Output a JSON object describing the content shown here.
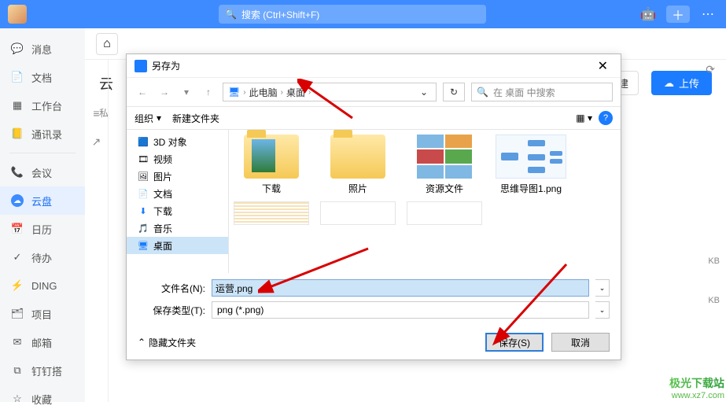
{
  "topbar": {
    "search_placeholder": "搜索 (Ctrl+Shift+F)"
  },
  "sidebar": {
    "items": [
      {
        "icon": "💬",
        "label": "消息"
      },
      {
        "icon": "📄",
        "label": "文档"
      },
      {
        "icon": "▦",
        "label": "工作台"
      },
      {
        "icon": "📒",
        "label": "通讯录"
      }
    ],
    "items2": [
      {
        "icon": "📞",
        "label": "会议"
      },
      {
        "icon": "☁",
        "label": "云盘",
        "active": true
      },
      {
        "icon": "📅",
        "label": "日历"
      },
      {
        "icon": "✓",
        "label": "待办"
      },
      {
        "icon": "⚡",
        "label": "DING"
      },
      {
        "icon": "🗂",
        "label": "项目"
      },
      {
        "icon": "✉",
        "label": "邮箱"
      },
      {
        "icon": "⧉",
        "label": "钉钉搭"
      },
      {
        "icon": "☆",
        "label": "收藏"
      }
    ]
  },
  "main": {
    "yun_title": "云",
    "private_label": "私",
    "new_btn": "建",
    "upload_btn": "上传",
    "kb_col": "KB"
  },
  "dialog": {
    "title": "另存为",
    "path": {
      "root": "此电脑",
      "leaf": "桌面"
    },
    "search_placeholder": "在 桌面 中搜索",
    "toolbar": {
      "organize": "组织",
      "newfolder": "新建文件夹"
    },
    "tree": [
      {
        "icon": "🟦",
        "label": "3D 对象"
      },
      {
        "icon": "🎞",
        "label": "视频"
      },
      {
        "icon": "🖼",
        "label": "图片"
      },
      {
        "icon": "📄",
        "label": "文档"
      },
      {
        "icon": "⬇",
        "label": "下载"
      },
      {
        "icon": "🎵",
        "label": "音乐"
      },
      {
        "icon": "🖥",
        "label": "桌面",
        "sel": true
      }
    ],
    "files": [
      {
        "label": "下载",
        "type": "folder-preview"
      },
      {
        "label": "照片",
        "type": "folder"
      },
      {
        "label": "资源文件",
        "type": "thumbs"
      },
      {
        "label": "思维导图1.png",
        "type": "mindmap"
      }
    ],
    "filename_label": "文件名(N):",
    "filename_value": "运营.png",
    "filetype_label": "保存类型(T):",
    "filetype_value": "png (*.png)",
    "hide_folders": "隐藏文件夹",
    "save_btn": "保存(S)",
    "cancel_btn": "取消"
  },
  "watermark": {
    "line1": "极光下载站",
    "line2": "www.xz7.com"
  }
}
